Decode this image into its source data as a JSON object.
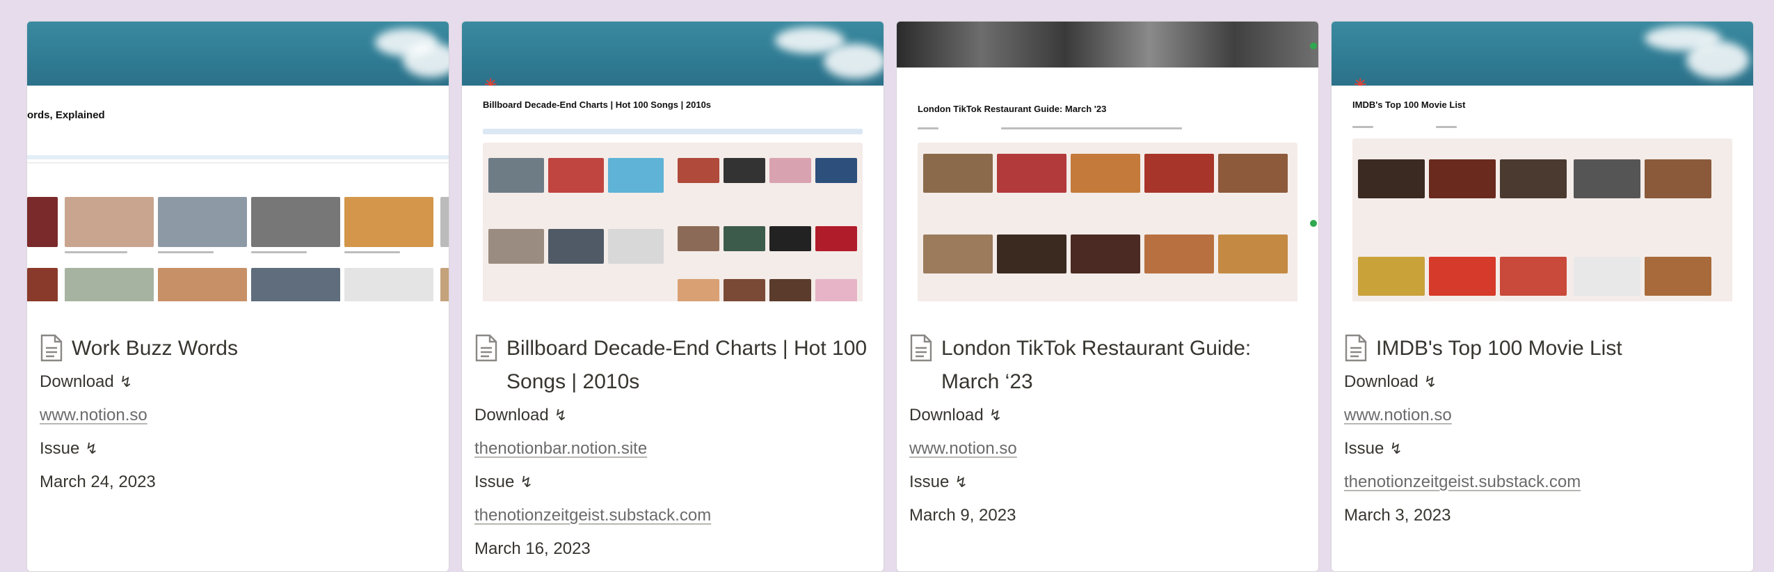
{
  "cards": [
    {
      "title": "Work Buzz  Words",
      "cover_heading": "ords, Explained",
      "download_label": "Download",
      "download_glyph": "↯",
      "download_value": "www.notion.so",
      "issue_label": "Issue",
      "issue_glyph": "↯",
      "issue_value": "",
      "date": "March 24, 2023"
    },
    {
      "title": "Billboard Decade-End Charts | Hot 100 Songs | 2010s",
      "cover_heading": "Billboard Decade-End Charts | Hot 100 Songs | 2010s",
      "download_label": "Download",
      "download_glyph": "↯",
      "download_value": "thenotionbar.notion.site",
      "issue_label": "Issue",
      "issue_glyph": "↯",
      "issue_value": "thenotionzeitgeist.substack.com",
      "date": "March 16, 2023"
    },
    {
      "title": "London TikTok Restaurant Guide: March ‘23",
      "cover_heading": "London TikTok Restaurant Guide: March '23",
      "download_label": "Download",
      "download_glyph": "↯",
      "download_value": "www.notion.so",
      "issue_label": "Issue",
      "issue_glyph": "↯",
      "issue_value": "",
      "date": "March 9, 2023"
    },
    {
      "title": "IMDB's Top 100 Movie List",
      "cover_heading": "IMDB's Top 100 Movie List",
      "download_label": "Download",
      "download_glyph": "↯",
      "download_value": "www.notion.so",
      "issue_label": "Issue",
      "issue_glyph": "↯",
      "issue_value": "thenotionzeitgeist.substack.com",
      "date": "March 3, 2023"
    }
  ],
  "colors": {
    "background": "#e6dcec",
    "card": "#ffffff",
    "banner": "#2f7b93",
    "text": "#37352f",
    "link": "#6b6b6b",
    "accent_asterisk": "#d6453a"
  },
  "icons": {
    "page": "document-icon",
    "property": "lightning-glyph"
  }
}
